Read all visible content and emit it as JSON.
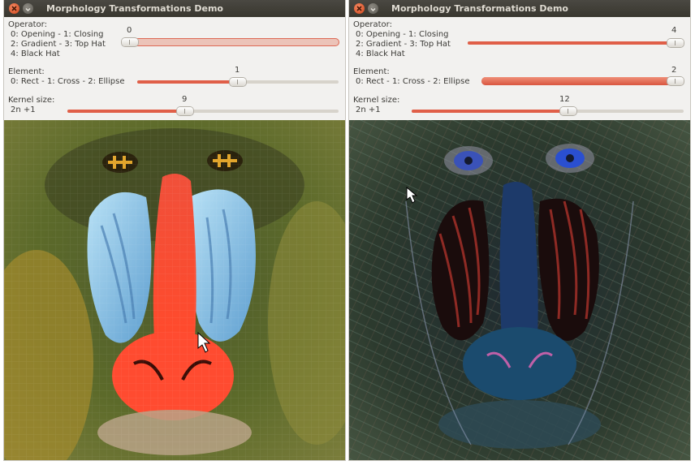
{
  "left_window": {
    "title": "Morphology Transformations Demo",
    "operator_label": "Operator:",
    "operator_options": [
      "0: Opening - 1: Closing",
      "2: Gradient - 3: Top Hat",
      "4: Black Hat"
    ],
    "operator_value": "0",
    "operator_fraction": 0.0,
    "element_label": "Element:",
    "element_options": "0: Rect - 1: Cross - 2: Ellipse",
    "element_value": "1",
    "element_fraction": 0.5,
    "kernel_label": "Kernel size:",
    "kernel_formula": "2n +1",
    "kernel_value": "9",
    "kernel_fraction": 0.43
  },
  "right_window": {
    "title": "Morphology Transformations Demo",
    "operator_label": "Operator:",
    "operator_options": [
      "0: Opening - 1: Closing",
      "2: Gradient - 3: Top Hat",
      "4: Black Hat"
    ],
    "operator_value": "4",
    "operator_fraction": 1.0,
    "element_label": "Element:",
    "element_options": "0: Rect - 1: Cross - 2: Ellipse",
    "element_value": "2",
    "element_fraction": 1.0,
    "kernel_label": "Kernel size:",
    "kernel_formula": "2n +1",
    "kernel_value": "12",
    "kernel_fraction": 0.58
  },
  "icons": [
    "close-icon",
    "minimize-icon",
    "mouse-pointer-icon"
  ],
  "colors": {
    "accent": "#e05f48",
    "titlebar": "#3f3d37",
    "panel": "#f2f1ef"
  }
}
